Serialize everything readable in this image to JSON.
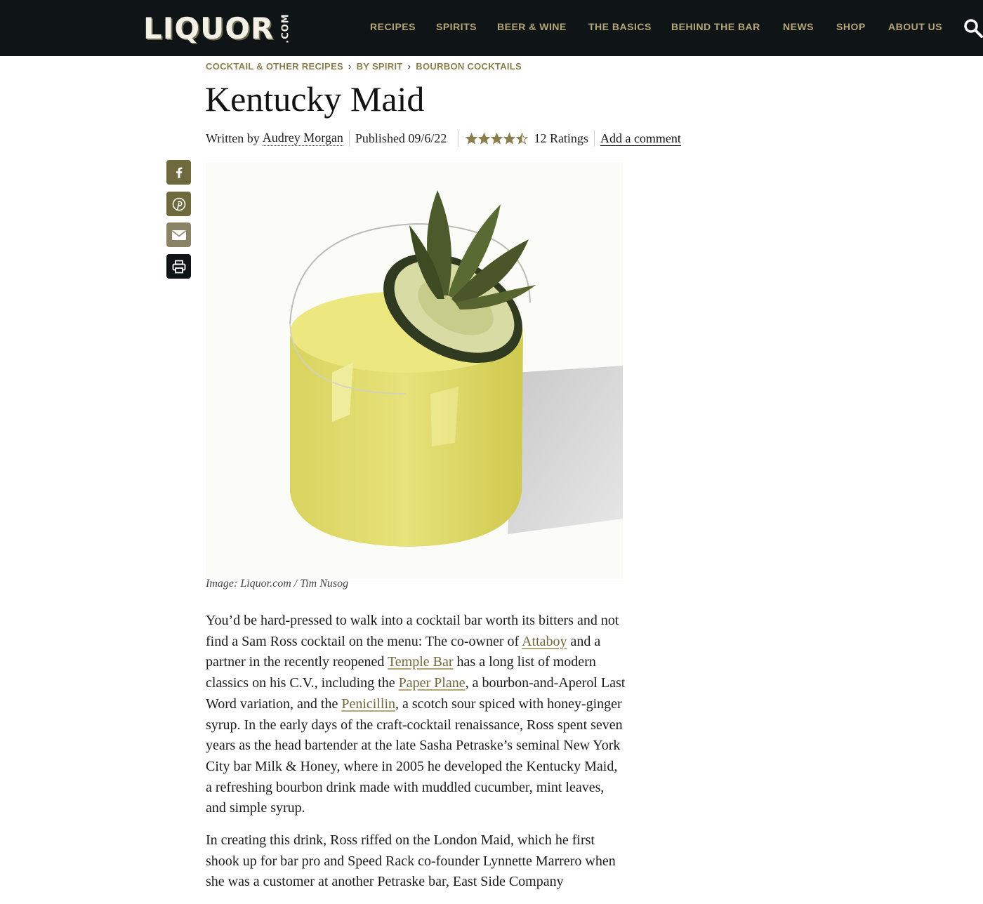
{
  "brand": {
    "logo_text": "LIQUOR",
    "logo_suffix": ".COM"
  },
  "nav": [
    {
      "label": "RECIPES"
    },
    {
      "label": "SPIRITS"
    },
    {
      "label": "BEER & WINE"
    },
    {
      "label": "THE BASICS"
    },
    {
      "label": "BEHIND THE BAR"
    },
    {
      "label": "NEWS"
    },
    {
      "label": "SHOP"
    },
    {
      "label": "ABOUT US"
    }
  ],
  "breadcrumb": [
    "COCKTAIL & OTHER RECIPES",
    "BY SPIRIT",
    "BOURBON COCKTAILS"
  ],
  "article": {
    "title": "Kentucky Maid",
    "written_by": "Written by",
    "author": "Audrey Morgan",
    "published": "Published 09/6/22",
    "rating_value": 4.5,
    "ratings_count": "12 Ratings",
    "comment_link": "Add a comment",
    "image_caption": "Image: Liquor.com / Tim Nusog",
    "p1": {
      "t1": "You’d be hard-pressed to walk into a cocktail bar worth its bitters and not find a Sam Ross cocktail on the menu: The co-owner of ",
      "l1": "Attaboy",
      "t2": " and a partner in the recently reopened ",
      "l2": "Temple Bar",
      "t3": " has a long list of modern classics on his C.V., including the ",
      "l3": "Paper Plane",
      "t4": ", a bourbon-and-Aperol Last Word variation, and the ",
      "l4": "Penicillin",
      "t5": ", a scotch sour spiced with honey-ginger syrup. In the early days of the craft-cocktail renaissance, Ross spent seven years as the head bartender at the late Sasha Petraske’s seminal New York City bar Milk & Honey, where in 2005 he developed the Kentucky Maid, a refreshing bourbon drink made with muddled cucumber, mint leaves, and simple syrup."
    },
    "p2": "In creating this drink, Ross riffed on the London Maid, which he first shook up for bar pro and Speed Rack co-founder Lynnette Marrero when she was a customer at another Petraske bar, East Side Company"
  },
  "share": [
    {
      "icon": "facebook-icon",
      "color": "#6f6a3e"
    },
    {
      "icon": "pinterest-icon",
      "color": "#6f6a3e"
    },
    {
      "icon": "email-icon",
      "color": "#8a8264"
    },
    {
      "icon": "print-icon",
      "color": "#0f1417"
    }
  ],
  "colors": {
    "nav_bg": "#0f1417",
    "nav_text": "#b4a676",
    "breadcrumb": "#8a7f4c",
    "star": "#8a7f4c",
    "link": "#6f6a3e"
  }
}
